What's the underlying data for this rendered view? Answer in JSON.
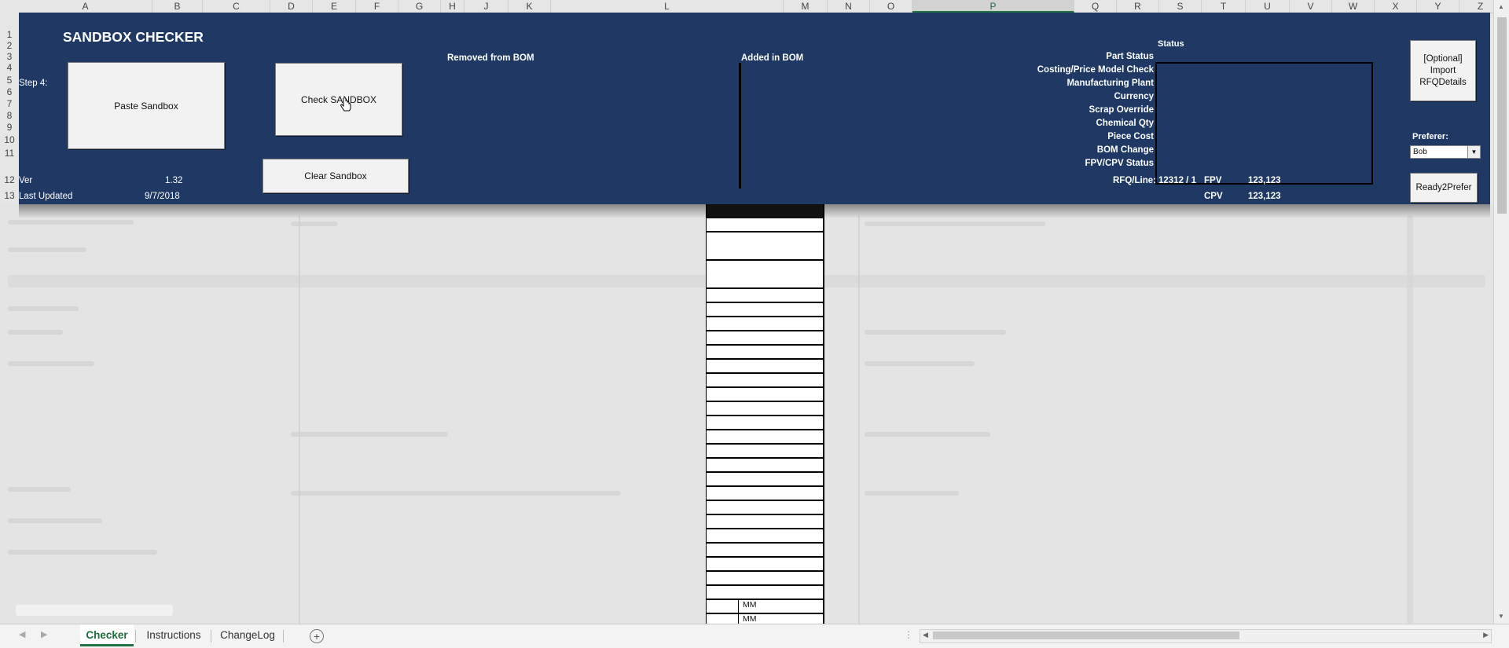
{
  "columns": [
    "A",
    "B",
    "C",
    "D",
    "E",
    "F",
    "G",
    "H",
    "J",
    "K",
    "L",
    "M",
    "N",
    "O",
    "P",
    "Q",
    "R",
    "S",
    "T",
    "U",
    "V",
    "W",
    "X",
    "Y",
    "Z",
    "AA"
  ],
  "selected_column": "P",
  "rows": [
    "1",
    "2",
    "3",
    "4",
    "5",
    "6",
    "7",
    "8",
    "9",
    "10",
    "11",
    "12",
    "13"
  ],
  "banner": {
    "title": "SANDBOX CHECKER",
    "step_label": "Step 4:",
    "paste_button": "Paste Sandbox",
    "check_button": "Check SANDBOX",
    "clear_button": "Clear Sandbox",
    "removed_label": "Removed from BOM",
    "added_label": "Added in BOM",
    "version_label": "Ver",
    "version_value": "1.32",
    "updated_label": "Last Updated",
    "updated_value": "9/7/2018",
    "status_header": "Status",
    "status_items": [
      "Part Status",
      "Costing/Price Model Check",
      "Manufacturing Plant",
      "Currency",
      "Scrap Override",
      "Chemical Qty",
      "Piece Cost",
      "BOM Change",
      "FPV/CPV Status"
    ],
    "rfq_label": "RFQ/Line:",
    "rfq_value": "12312 / 1",
    "fpv_label": "FPV",
    "fpv_value": "123,123",
    "cpv_label": "CPV",
    "cpv_value": "123,123",
    "import_button": "[Optional] Import RFQDetails",
    "preferer_label": "Preferer:",
    "preferer_value": "Bob",
    "ready_button": "Ready2Prefer"
  },
  "center_cells": [
    "MM",
    "MM"
  ],
  "tabs": [
    {
      "label": "Checker",
      "active": true
    },
    {
      "label": "Instructions",
      "active": false
    },
    {
      "label": "ChangeLog",
      "active": false
    }
  ],
  "add_sheet_icon": "plus-circle-icon",
  "colors": {
    "banner": "#1f3864",
    "accent": "#217346"
  }
}
